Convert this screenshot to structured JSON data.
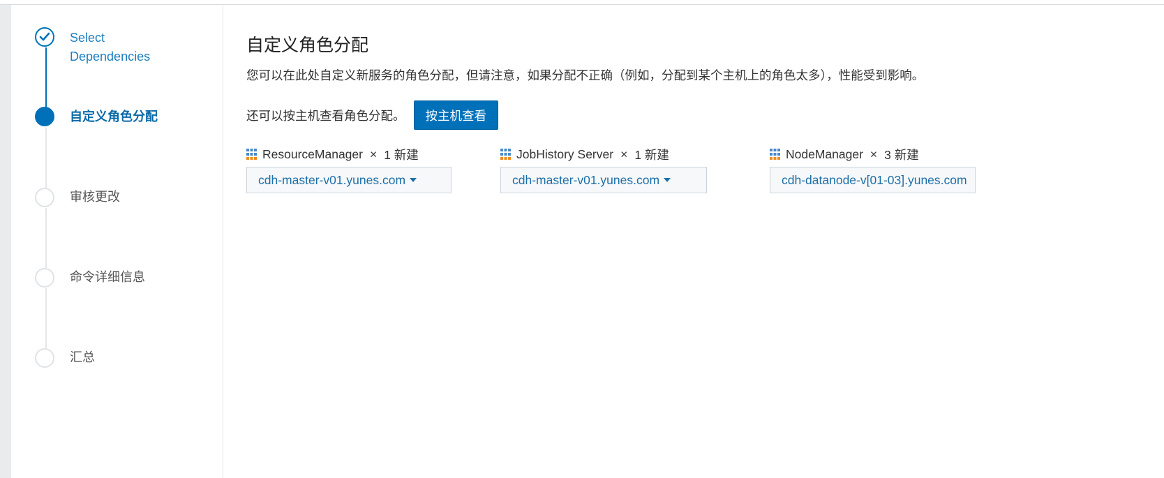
{
  "wizard": {
    "steps": [
      {
        "label_line1": "Select",
        "label_line2": "Dependencies",
        "state": "done"
      },
      {
        "label": "自定义角色分配",
        "state": "active"
      },
      {
        "label": "审核更改",
        "state": "todo"
      },
      {
        "label": "命令详细信息",
        "state": "todo"
      },
      {
        "label": "汇总",
        "state": "todo"
      }
    ]
  },
  "main": {
    "title": "自定义角色分配",
    "description": "您可以在此处自定义新服务的角色分配，但请注意，如果分配不正确（例如，分配到某个主机上的角色太多），性能受到影响。",
    "host_view_text": "还可以按主机查看角色分配。",
    "host_view_button": "按主机查看",
    "roles": [
      {
        "name": "ResourceManager",
        "sep": "×",
        "count": "1 新建",
        "host": "cdh-master-v01.yunes.com",
        "icon": "role-grid-icon"
      },
      {
        "name": "JobHistory Server",
        "sep": "×",
        "count": "1 新建",
        "host": "cdh-master-v01.yunes.com",
        "icon": "role-grid-icon"
      },
      {
        "name": "NodeManager",
        "sep": "×",
        "count": "3 新建",
        "host": "cdh-datanode-v[01-03].yunes.com",
        "icon": "role-grid-icon"
      }
    ]
  },
  "colors": {
    "accent": "#0071b9",
    "link": "#1d6fa8",
    "icon_blue": "#4a89c8",
    "icon_orange": "#f08c1e"
  }
}
